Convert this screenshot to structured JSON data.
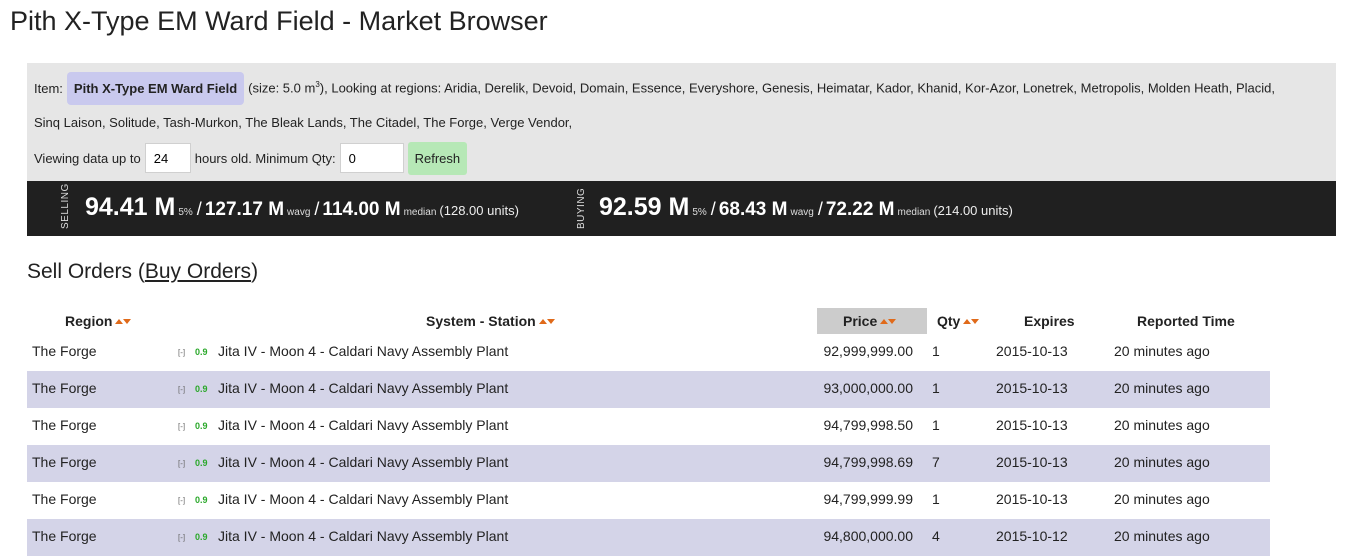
{
  "page_title": "Pith X-Type EM Ward Field - Market Browser",
  "filters": {
    "item_prefix": "Item:",
    "item_name": "Pith X-Type EM Ward Field",
    "size_text": "(size: 5.0 m",
    "size_sup": "3",
    "size_suffix": "), Looking at regions: Aridia, Derelik, Devoid, Domain, Essence, Everyshore, Genesis, Heimatar, Kador, Khanid, Kor-Azor, Lonetrek, Metropolis, Molden Heath, Placid,",
    "regions_line2": "Sinq Laison, Solitude, Tash-Murkon, The Bleak Lands, The Citadel, The Forge, Verge Vendor,",
    "viewing_prefix": "Viewing data up to",
    "hours_value": "24",
    "hours_suffix": "hours old. Minimum Qty:",
    "min_qty_value": "0",
    "refresh_label": "Refresh"
  },
  "stats": {
    "selling": {
      "label": "SELLING",
      "pct": "94.41 M",
      "pct_unit": "5%",
      "wavg": "127.17 M",
      "wavg_unit": "wavg",
      "median": "114.00 M",
      "median_unit": "median",
      "units": "(128.00 units)"
    },
    "buying": {
      "label": "BUYING",
      "pct": "92.59 M",
      "pct_unit": "5%",
      "wavg": "68.43 M",
      "wavg_unit": "wavg",
      "median": "72.22 M",
      "median_unit": "median",
      "units": "(214.00 units)"
    }
  },
  "section": {
    "title_prefix": "Sell Orders (",
    "buy_link": "Buy Orders",
    "title_suffix": ")"
  },
  "table": {
    "headers": {
      "region": "Region",
      "station": "System - Station",
      "price": "Price",
      "qty": "Qty",
      "expires": "Expires",
      "reported": "Reported Time"
    },
    "rows": [
      {
        "region": "The Forge",
        "toggle": "[-]",
        "security": "0.9",
        "station": "Jita IV - Moon 4 - Caldari Navy Assembly Plant",
        "price": "92,999,999.00",
        "qty": "1",
        "expires": "2015-10-13",
        "reported": "20 minutes ago"
      },
      {
        "region": "The Forge",
        "toggle": "[-]",
        "security": "0.9",
        "station": "Jita IV - Moon 4 - Caldari Navy Assembly Plant",
        "price": "93,000,000.00",
        "qty": "1",
        "expires": "2015-10-13",
        "reported": "20 minutes ago"
      },
      {
        "region": "The Forge",
        "toggle": "[-]",
        "security": "0.9",
        "station": "Jita IV - Moon 4 - Caldari Navy Assembly Plant",
        "price": "94,799,998.50",
        "qty": "1",
        "expires": "2015-10-13",
        "reported": "20 minutes ago"
      },
      {
        "region": "The Forge",
        "toggle": "[-]",
        "security": "0.9",
        "station": "Jita IV - Moon 4 - Caldari Navy Assembly Plant",
        "price": "94,799,998.69",
        "qty": "7",
        "expires": "2015-10-13",
        "reported": "20 minutes ago"
      },
      {
        "region": "The Forge",
        "toggle": "[-]",
        "security": "0.9",
        "station": "Jita IV - Moon 4 - Caldari Navy Assembly Plant",
        "price": "94,799,999.99",
        "qty": "1",
        "expires": "2015-10-13",
        "reported": "20 minutes ago"
      },
      {
        "region": "The Forge",
        "toggle": "[-]",
        "security": "0.9",
        "station": "Jita IV - Moon 4 - Caldari Navy Assembly Plant",
        "price": "94,800,000.00",
        "qty": "4",
        "expires": "2015-10-12",
        "reported": "20 minutes ago"
      }
    ]
  },
  "colors": {
    "item_pill": "#c9c9ee",
    "stat_bar": "#202020",
    "row_alt": "#d4d4e8",
    "refresh_button": "#b6e8b6",
    "sort_arrow": "#e06a1a",
    "security_status": "#2aa82a"
  }
}
